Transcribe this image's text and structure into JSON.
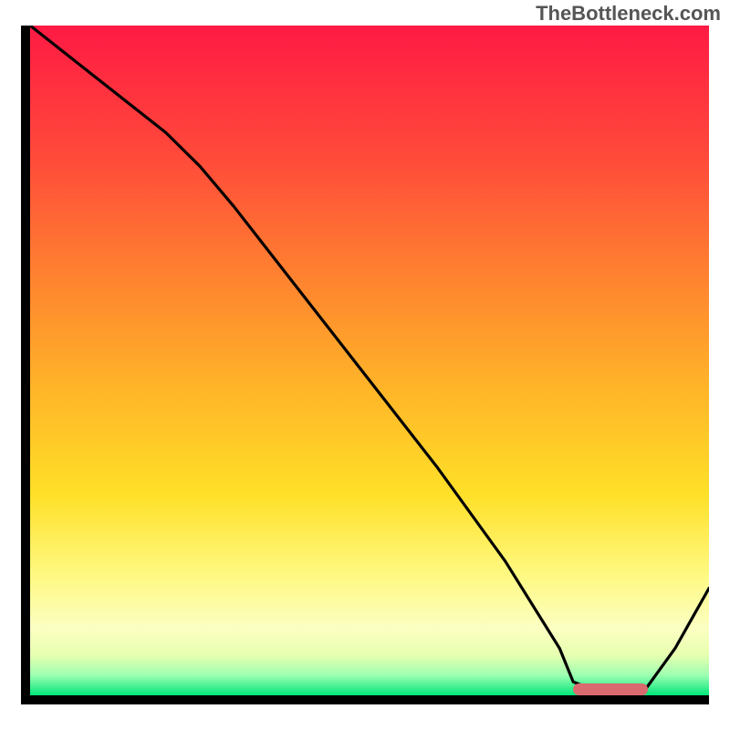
{
  "watermark": "TheBottleneck.com",
  "chart_data": {
    "type": "line",
    "title": "",
    "xlabel": "",
    "ylabel": "",
    "xlim": [
      0,
      100
    ],
    "ylim": [
      0,
      100
    ],
    "x": [
      0,
      10,
      20,
      25,
      30,
      40,
      50,
      60,
      70,
      78,
      80,
      85,
      90,
      95,
      100
    ],
    "values": [
      100,
      92,
      84,
      79,
      73,
      60,
      47,
      34,
      20,
      7,
      2,
      0,
      0,
      7,
      16
    ],
    "series": [
      {
        "name": "curve",
        "color": "#000000"
      }
    ],
    "optimal_marker": {
      "x_start": 80,
      "x_end": 91,
      "y": 0,
      "color": "#d96a6f"
    },
    "background_gradient": {
      "stops": [
        {
          "pos": 0.0,
          "color": "#ff1a44"
        },
        {
          "pos": 0.2,
          "color": "#ff4b3a"
        },
        {
          "pos": 0.4,
          "color": "#ff8a2e"
        },
        {
          "pos": 0.55,
          "color": "#ffb728"
        },
        {
          "pos": 0.7,
          "color": "#ffe028"
        },
        {
          "pos": 0.82,
          "color": "#fff982"
        },
        {
          "pos": 0.9,
          "color": "#fbffc2"
        },
        {
          "pos": 0.94,
          "color": "#e7ffb0"
        },
        {
          "pos": 0.97,
          "color": "#9dffb1"
        },
        {
          "pos": 1.0,
          "color": "#00e67a"
        }
      ]
    }
  }
}
